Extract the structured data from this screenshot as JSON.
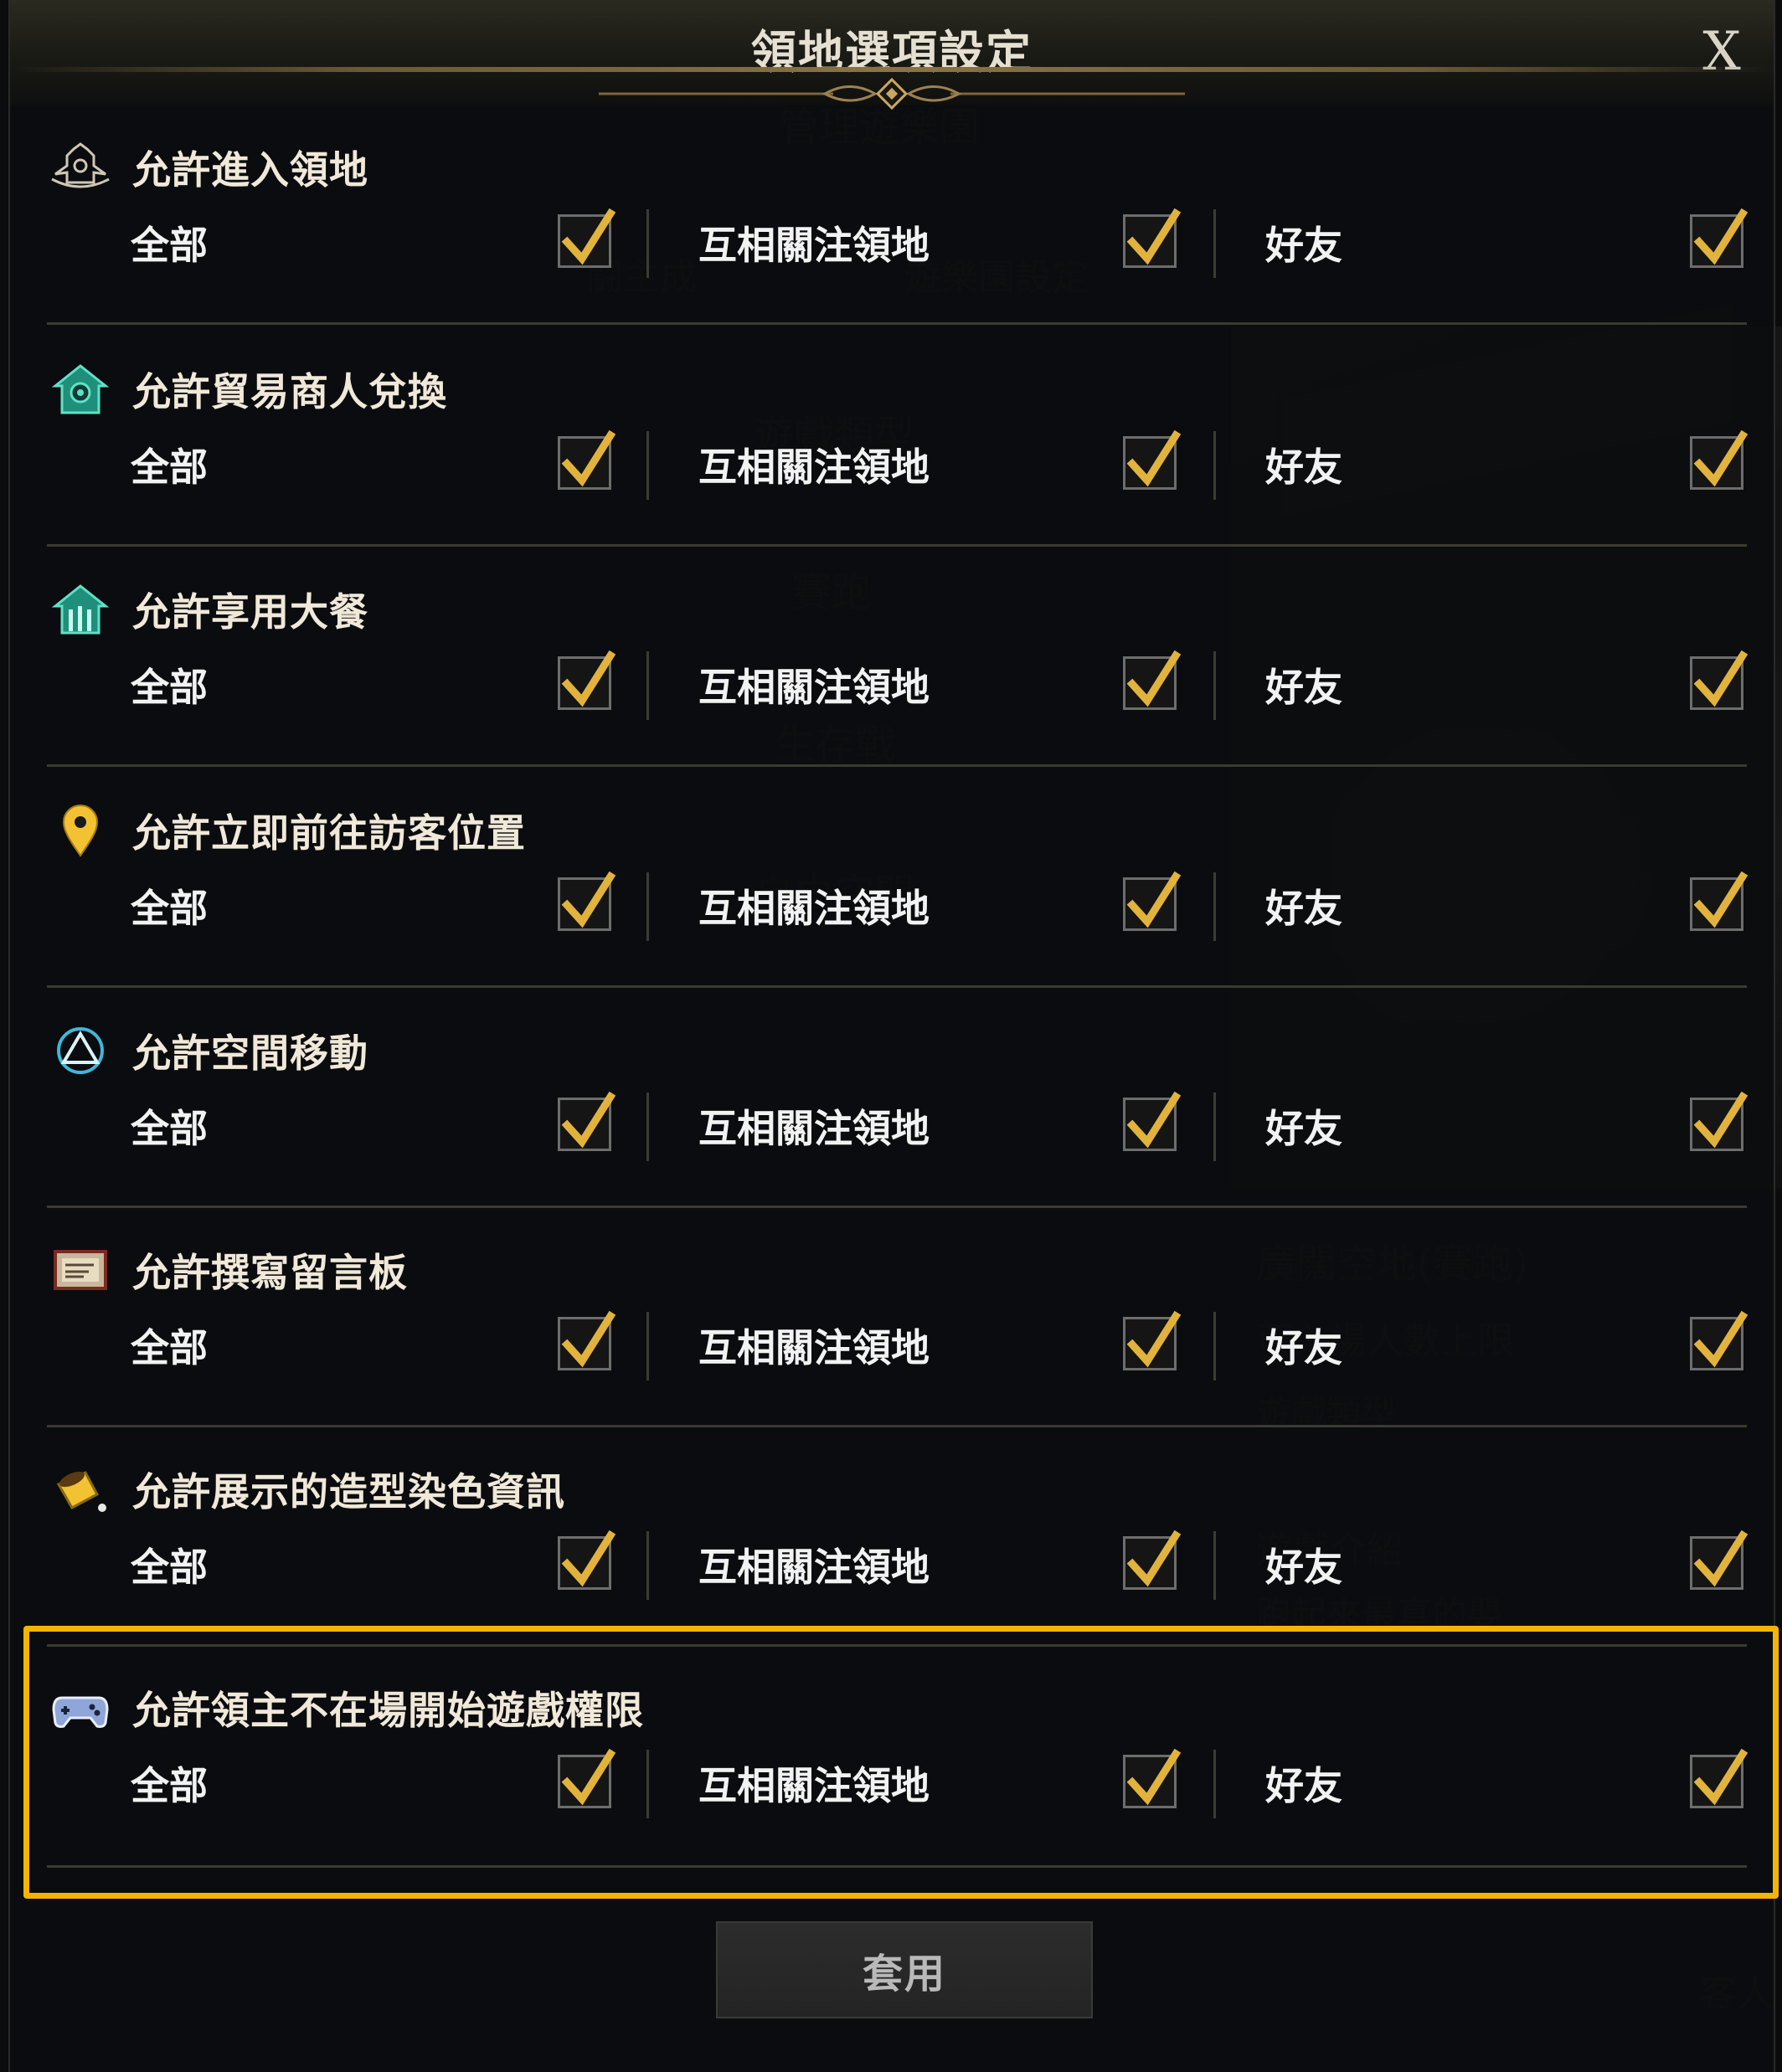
{
  "dialog": {
    "title": "領地選項設定",
    "close_label": "X",
    "apply_label": "套用"
  },
  "option_labels": {
    "all": "全部",
    "mutual": "互相關注領地",
    "friends": "好友"
  },
  "rows": [
    {
      "title": "允許進入領地",
      "icon": "castle-icon",
      "all": true,
      "mutual": true,
      "friends": true
    },
    {
      "title": "允許貿易商人兌換",
      "icon": "merchant-house-icon",
      "all": true,
      "mutual": true,
      "friends": true
    },
    {
      "title": "允許享用大餐",
      "icon": "feast-house-icon",
      "all": true,
      "mutual": true,
      "friends": true
    },
    {
      "title": "允許立即前往訪客位置",
      "icon": "location-pin-icon",
      "all": true,
      "mutual": true,
      "friends": true
    },
    {
      "title": "允許空間移動",
      "icon": "teleport-icon",
      "all": true,
      "mutual": true,
      "friends": true
    },
    {
      "title": "允許撰寫留言板",
      "icon": "message-board-icon",
      "all": true,
      "mutual": true,
      "friends": true
    },
    {
      "title": "允許展示的造型染色資訊",
      "icon": "dye-bucket-icon",
      "all": true,
      "mutual": true,
      "friends": true
    },
    {
      "title": "允許領主不在場開始遊戲權限",
      "icon": "gamepad-icon",
      "all": true,
      "mutual": true,
      "friends": true
    }
  ],
  "background_ghost_text": [
    "管理遊樂園",
    "闘主成",
    "遊樂園設定",
    "遊戲類型",
    "賽跑",
    "生存戰",
    "自由空間",
    "廣闊空地(賽跑)",
    "可入場人數上限",
    "遊戲類型",
    "遊戲介紹",
    "跑起來最真的嬰",
    "客人"
  ],
  "colors": {
    "highlight": "#f4b400",
    "checkmark": "#e2b33c",
    "title_text": "#e6e0d2"
  }
}
